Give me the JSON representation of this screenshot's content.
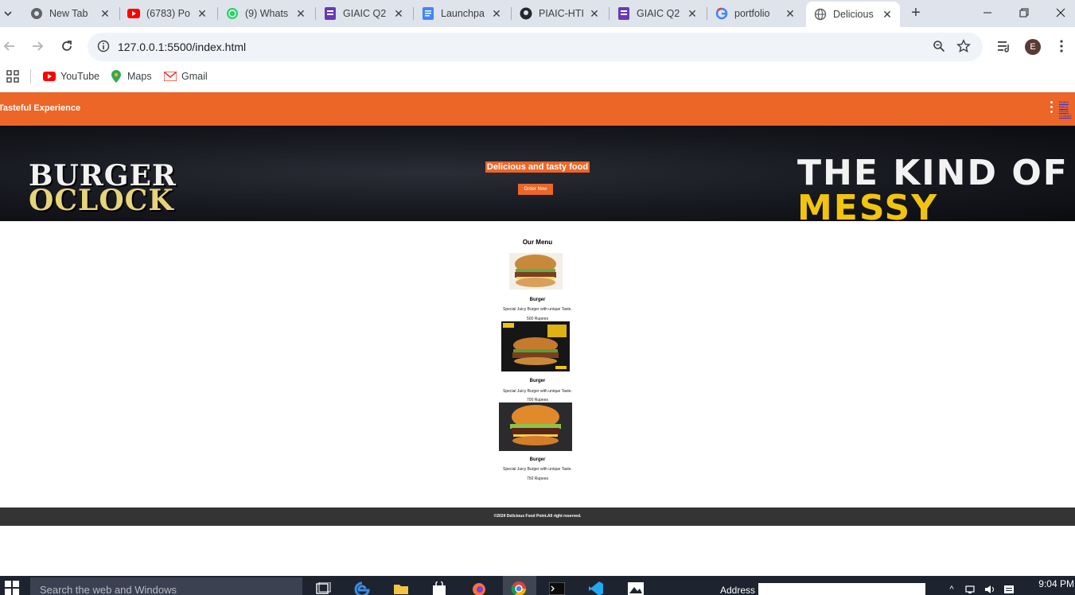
{
  "browser": {
    "tabs": [
      {
        "title": "New Tab",
        "icon": "chrome-icon"
      },
      {
        "title": "(6783) Po",
        "icon": "youtube-icon"
      },
      {
        "title": "(9) Whats",
        "icon": "whatsapp-icon"
      },
      {
        "title": "GIAIC Q2",
        "icon": "forms-icon"
      },
      {
        "title": "Launchpa",
        "icon": "docs-icon"
      },
      {
        "title": "PIAIC-HTI",
        "icon": "github-icon"
      },
      {
        "title": "GIAIC Q2",
        "icon": "forms-icon"
      },
      {
        "title": "portfolio",
        "icon": "google-icon"
      },
      {
        "title": "Delicious",
        "icon": "globe-icon"
      }
    ],
    "new_tab": "+",
    "url": "127.0.0.1:5500/index.html",
    "profile_initial": "E",
    "bookmarks": [
      {
        "label": "YouTube",
        "icon": "youtube-icon"
      },
      {
        "label": "Maps",
        "icon": "maps-icon"
      },
      {
        "label": "Gmail",
        "icon": "gmail-icon"
      }
    ]
  },
  "site": {
    "brand": "Tasteful Experience",
    "nav_links": [
      "Home",
      "Menu",
      "About",
      "Contact"
    ],
    "hero": {
      "left_text_line1": "BURGER",
      "left_text_line2": "OCLOCK",
      "right_text_line1": "THE KIND OF",
      "right_text_line2": "MESSY",
      "tagline": "Delicious and tasty food",
      "cta": "Order Now"
    },
    "menu": {
      "title": "Our Menu",
      "items": [
        {
          "name": "Burger",
          "description": "Special Juicy Burger with unique Taste.",
          "price": "500 Rupees"
        },
        {
          "name": "Burger",
          "description": "Special Juicy Burger with unique Taste.",
          "price": "700 Rupees"
        },
        {
          "name": "Burger",
          "description": "Special Juicy Burger with unique Taste.",
          "price": "750 Rupees"
        }
      ]
    },
    "footer": "©2024 Delicious Food Point.All right reserved."
  },
  "taskbar": {
    "search_placeholder": "Search the web and Windows",
    "address_label": "Address",
    "time": "9:04 PM"
  },
  "colors": {
    "accent": "#eb6627",
    "footer": "#343434",
    "tabstrip": "#dfe3eb",
    "taskbar": "#1d2430"
  }
}
